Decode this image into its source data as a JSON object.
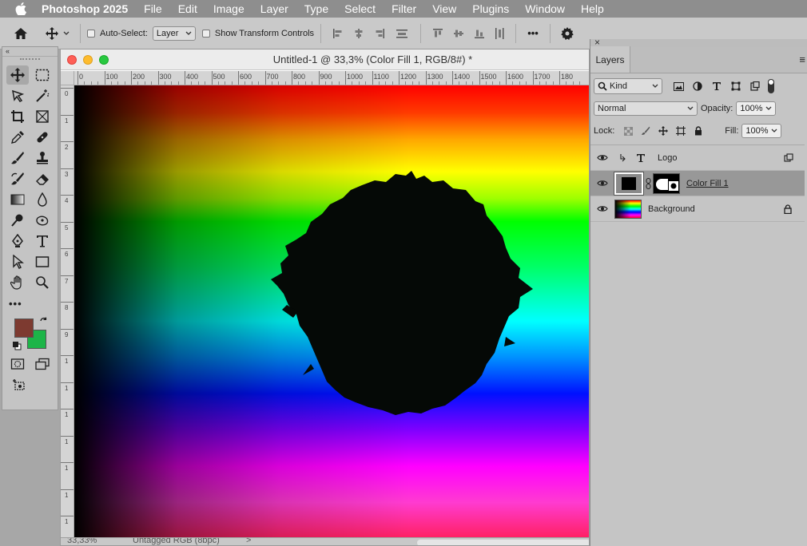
{
  "menubar": {
    "app": "Photoshop 2025",
    "items": [
      "File",
      "Edit",
      "Image",
      "Layer",
      "Type",
      "Select",
      "Filter",
      "View",
      "Plugins",
      "Window",
      "Help"
    ]
  },
  "options": {
    "auto_select_label": "Auto-Select:",
    "auto_select_target": "Layer",
    "show_transform_label": "Show Transform Controls",
    "more_label": "•••"
  },
  "toolbar": {
    "collapse_label": "«",
    "more_label": "•••",
    "foreground_color": "#7d3a30",
    "background_color": "#1db548"
  },
  "document": {
    "title": "Untitled-1 @ 33,3% (Color Fill 1, RGB/8#) *",
    "ruler_ticks": [
      "0",
      "100",
      "200",
      "300",
      "400",
      "500",
      "600",
      "700",
      "800",
      "900",
      "1000",
      "1100",
      "1200",
      "1300",
      "1400",
      "1500",
      "1600",
      "1700",
      "180"
    ],
    "ruler_v_ticks": [
      "0",
      "1",
      "2",
      "3",
      "4",
      "5",
      "6",
      "7",
      "8",
      "9",
      "1",
      "1",
      "1",
      "1",
      "1",
      "1",
      "1",
      "1"
    ],
    "status_zoom": "33,33%",
    "status_profile": "Untagged RGB (8bpc)",
    "status_arrow": ">"
  },
  "layers_panel": {
    "tab": "Layers",
    "close_label": "×",
    "menu_label": "≡",
    "filter_kind": "Kind",
    "blend_mode": "Normal",
    "opacity_label": "Opacity:",
    "opacity_value": "100%",
    "lock_label": "Lock:",
    "fill_label": "Fill:",
    "fill_value": "100%",
    "layers": [
      {
        "name": "Logo",
        "type": "text"
      },
      {
        "name": "Color Fill 1",
        "type": "fill",
        "selected": true
      },
      {
        "name": "Background",
        "type": "image",
        "locked": true
      }
    ]
  }
}
